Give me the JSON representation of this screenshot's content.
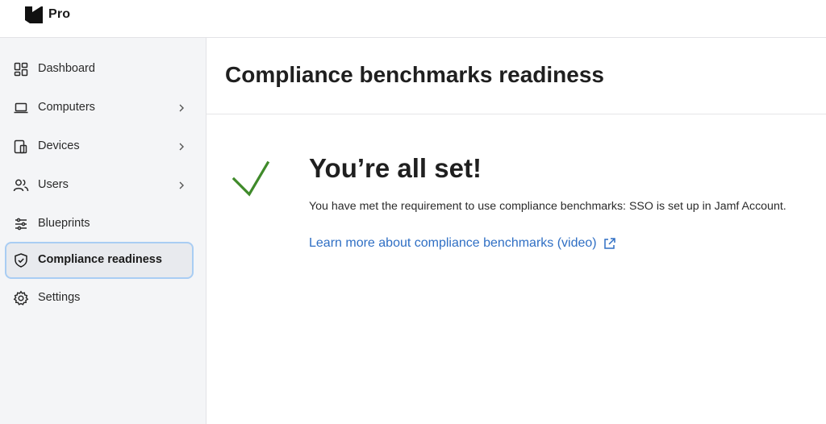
{
  "brand": {
    "name": "Pro",
    "logo_icon": "jamf-logo-icon"
  },
  "sidebar": {
    "items": [
      {
        "label": "Dashboard",
        "icon": "dashboard-icon",
        "has_chevron": false,
        "active": false
      },
      {
        "label": "Computers",
        "icon": "laptop-icon",
        "has_chevron": true,
        "active": false
      },
      {
        "label": "Devices",
        "icon": "devices-icon",
        "has_chevron": true,
        "active": false
      },
      {
        "label": "Users",
        "icon": "users-icon",
        "has_chevron": true,
        "active": false
      },
      {
        "label": "Blueprints",
        "icon": "sliders-icon",
        "has_chevron": false,
        "active": false
      },
      {
        "label": "Compliance readiness",
        "icon": "shield-check-icon",
        "has_chevron": false,
        "active": true
      },
      {
        "label": "Settings",
        "icon": "gear-icon",
        "has_chevron": false,
        "active": false
      }
    ]
  },
  "main": {
    "title": "Compliance benchmarks readiness",
    "status": {
      "icon": "checkmark-icon",
      "heading": "You’re all set!",
      "body": "You have met the requirement to use compliance benchmarks: SSO is set up in Jamf Account.",
      "link_label": "Learn more about compliance benchmarks (video)",
      "link_icon": "external-link-icon"
    }
  },
  "colors": {
    "accent_link": "#2f6fc4",
    "success_green": "#3f8a2a",
    "active_border": "#a9cdf3",
    "sidebar_bg": "#f4f5f7"
  }
}
